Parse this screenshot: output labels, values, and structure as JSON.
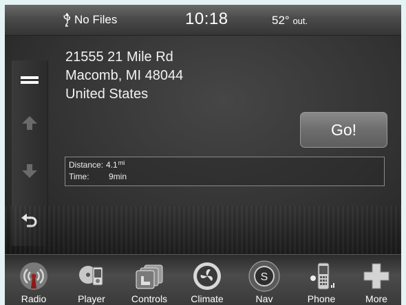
{
  "status": {
    "usb_text": "No Files",
    "time": "10:18",
    "temp": "52°",
    "temp_suffix": "out."
  },
  "address": {
    "line1": "21555 21 Mile Rd",
    "line2": "Macomb, MI 48044",
    "line3": "United States"
  },
  "go_label": "Go!",
  "route": {
    "distance_label": "Distance:",
    "distance_value": "4.1",
    "distance_unit": "mi",
    "time_label": "Time:",
    "time_value": "9min"
  },
  "sidebar_icons": [
    "menu-icon",
    "arrow-up-icon",
    "arrow-down-icon",
    "back-icon"
  ],
  "nav": {
    "items": [
      {
        "label": "Radio",
        "icon": "radio-icon"
      },
      {
        "label": "Player",
        "icon": "player-icon"
      },
      {
        "label": "Controls",
        "icon": "controls-icon"
      },
      {
        "label": "Climate",
        "icon": "climate-icon"
      },
      {
        "label": "Nav",
        "icon": "nav-icon"
      },
      {
        "label": "Phone",
        "icon": "phone-icon"
      },
      {
        "label": "More",
        "icon": "more-icon"
      }
    ]
  }
}
